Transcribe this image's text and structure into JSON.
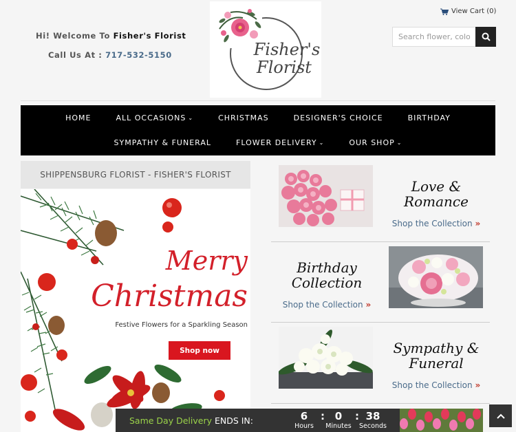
{
  "header": {
    "welcome_prefix": "Hi! Welcome To ",
    "welcome_name": "Fisher's Florist",
    "call_prefix": "Call Us At : ",
    "phone": "717-532-5150",
    "logo_line1": "Fisher's",
    "logo_line2": "Florist",
    "cart_label": "View Cart (0)",
    "search_placeholder": "Search flower, color"
  },
  "nav": {
    "row1": [
      {
        "label": "HOME",
        "dropdown": false
      },
      {
        "label": "ALL OCCASIONS",
        "dropdown": true
      },
      {
        "label": "CHRISTMAS",
        "dropdown": false
      },
      {
        "label": "DESIGNER'S CHOICE",
        "dropdown": false
      },
      {
        "label": "BIRTHDAY",
        "dropdown": false
      }
    ],
    "row2": [
      {
        "label": "SYMPATHY & FUNERAL",
        "dropdown": false
      },
      {
        "label": "FLOWER DELIVERY",
        "dropdown": true
      },
      {
        "label": "OUR SHOP",
        "dropdown": true
      }
    ]
  },
  "promo": {
    "title": "SHIPPENSBURG FLORIST - FISHER'S FLORIST",
    "merry": "Merry",
    "christmas": "Christmas",
    "tagline": "Festive Flowers for a Sparkling Season",
    "button": "Shop now"
  },
  "collections": [
    {
      "name_line1": "Love &",
      "name_line2": "Romance",
      "link": "Shop the Collection",
      "raquo": "»"
    },
    {
      "name_line1": "Birthday",
      "name_line2": "Collection",
      "link": "Shop the Collection",
      "raquo": "»"
    },
    {
      "name_line1": "Sympathy &",
      "name_line2": "Funeral",
      "link": "Shop the Collection",
      "raquo": "»"
    }
  ],
  "countdown": {
    "label_green": "Same Day Delivery",
    "label_white": " ENDS IN:",
    "hours": "6",
    "minutes": "0",
    "seconds": "38",
    "hours_label": "Hours",
    "minutes_label": "Minutes",
    "seconds_label": "Seconds",
    "separator": ":"
  },
  "colors": {
    "nav_bg": "#000000",
    "accent_red": "#d3202a",
    "link_blue": "#4a6b8a",
    "countdown_green": "#9bd34a",
    "countdown_bg": "#333333"
  },
  "icons": {
    "cart": "cart-icon",
    "search": "search-icon",
    "chevron": "chevron-down-icon",
    "back_to_top": "chevron-up-icon"
  }
}
